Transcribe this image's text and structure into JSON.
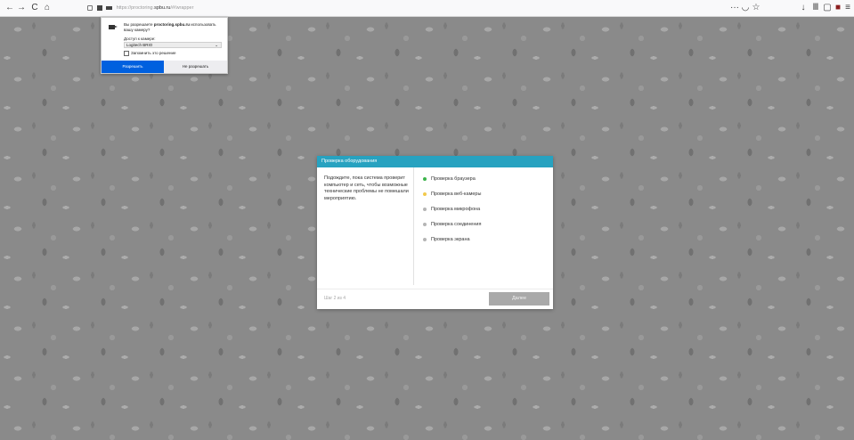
{
  "browser": {
    "url_prefix": "https://proctoring.",
    "url_host": "spbu.ru",
    "url_path": "/#/wrapper",
    "icons": {
      "back": "←",
      "forward": "→",
      "reload": "C",
      "home": "⌂",
      "more": "···",
      "pocket": "◡",
      "star": "☆",
      "download": "↓",
      "library": "Ⅲ",
      "sidebar": "▢",
      "ext": "■",
      "menu": "≡"
    }
  },
  "permission": {
    "question_pre": "Вы разрешаете ",
    "question_host": "proctoring.spbu.ru",
    "question_post": " использовать вашу камеру?",
    "access_label": "Доступ к камере:",
    "camera": "Logitech BRIO",
    "remember": "Запомнить это решение",
    "allow": "Разрешить",
    "deny": "Не разрешать"
  },
  "dialog": {
    "title": "Проверка оборудования",
    "description": "Подождите, пока система проверит компьютер и сеть, чтобы возможные технические проблемы не помешали мероприятию.",
    "checks": [
      {
        "label": "Проверка браузера",
        "color": "#3cb44b"
      },
      {
        "label": "Проверка веб-камеры",
        "color": "#f2c94c"
      },
      {
        "label": "Проверка микрофона",
        "color": "#b5b5b5"
      },
      {
        "label": "Проверка соединения",
        "color": "#b5b5b5"
      },
      {
        "label": "Проверка экрана",
        "color": "#b5b5b5"
      }
    ],
    "step": "Шаг 2 из 4",
    "next": "Далее"
  }
}
